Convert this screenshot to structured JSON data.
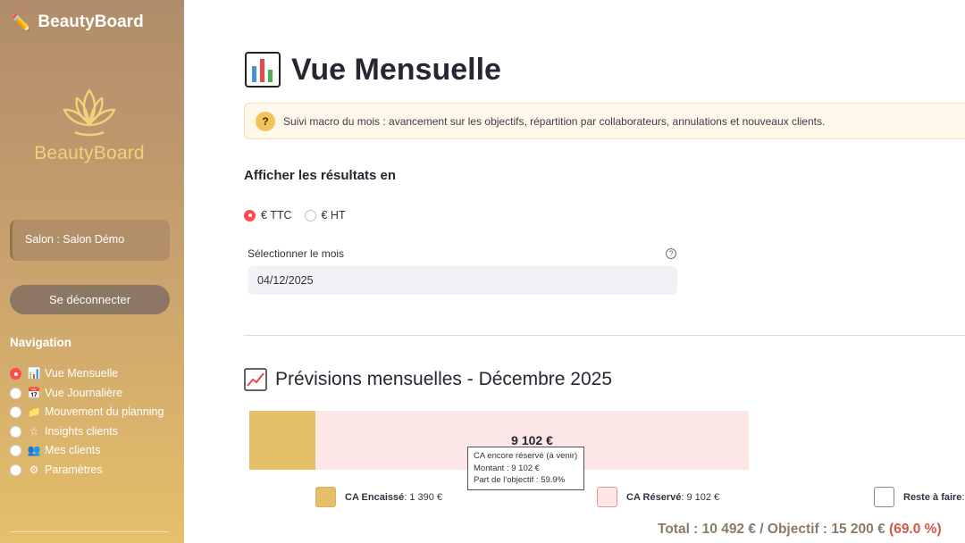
{
  "sidebar": {
    "app_name": "BeautyBoard",
    "logo_text": "BeautyBoard",
    "salon": "Salon : Salon Démo",
    "logout_label": "Se déconnecter",
    "nav_title": "Navigation",
    "items": [
      {
        "label": "Vue Mensuelle",
        "icon": "bar-chart-icon",
        "glyph": "📊",
        "selected": true
      },
      {
        "label": "Vue Journalière",
        "icon": "calendar-icon",
        "glyph": "📅",
        "selected": false
      },
      {
        "label": "Mouvement du planning",
        "icon": "folder-icon",
        "glyph": "📁",
        "selected": false
      },
      {
        "label": "Insights clients",
        "icon": "star-icon",
        "glyph": "☆",
        "selected": false
      },
      {
        "label": "Mes clients",
        "icon": "people-icon",
        "glyph": "👥",
        "selected": false
      },
      {
        "label": "Paramètres",
        "icon": "gear-icon",
        "glyph": "⚙",
        "selected": false
      }
    ]
  },
  "main": {
    "title": "Vue Mensuelle",
    "info": "Suivi macro du mois : avancement sur les objectifs, répartition par collaborateurs, annulations et nouveaux clients.",
    "display_label": "Afficher les résultats en",
    "options": {
      "ttc": "€ TTC",
      "ht": "€ HT",
      "selected": "€ TTC"
    },
    "month_label": "Sélectionner le mois",
    "month_value": "04/12/2025",
    "forecast_title": "Prévisions mensuelles - Décembre 2025",
    "reserved_value": "9 102 €",
    "tooltip": {
      "line1": "CA encore réservé (à venir)",
      "line2": "Montant : 9 102 €",
      "line3": "Part de l'objectif : 59.9%"
    },
    "legend": [
      {
        "name": "CA Encaissé",
        "value": " : 1 390 €",
        "color": "#e6c068"
      },
      {
        "name": "CA Réservé",
        "value": " : 9 102 €",
        "color": "#fde6e6"
      },
      {
        "name": "Reste à faire",
        "value": " :",
        "color": "#ffffff"
      }
    ],
    "total_text": "Total : 10 492 € / Objectif : 15 200 €",
    "total_pct": "(69.0 %)"
  },
  "chart_data": {
    "type": "bar",
    "categories": [
      "CA Encaissé",
      "CA Réservé"
    ],
    "values": [
      1390,
      9102
    ],
    "objective": 15200,
    "unit": "€"
  }
}
